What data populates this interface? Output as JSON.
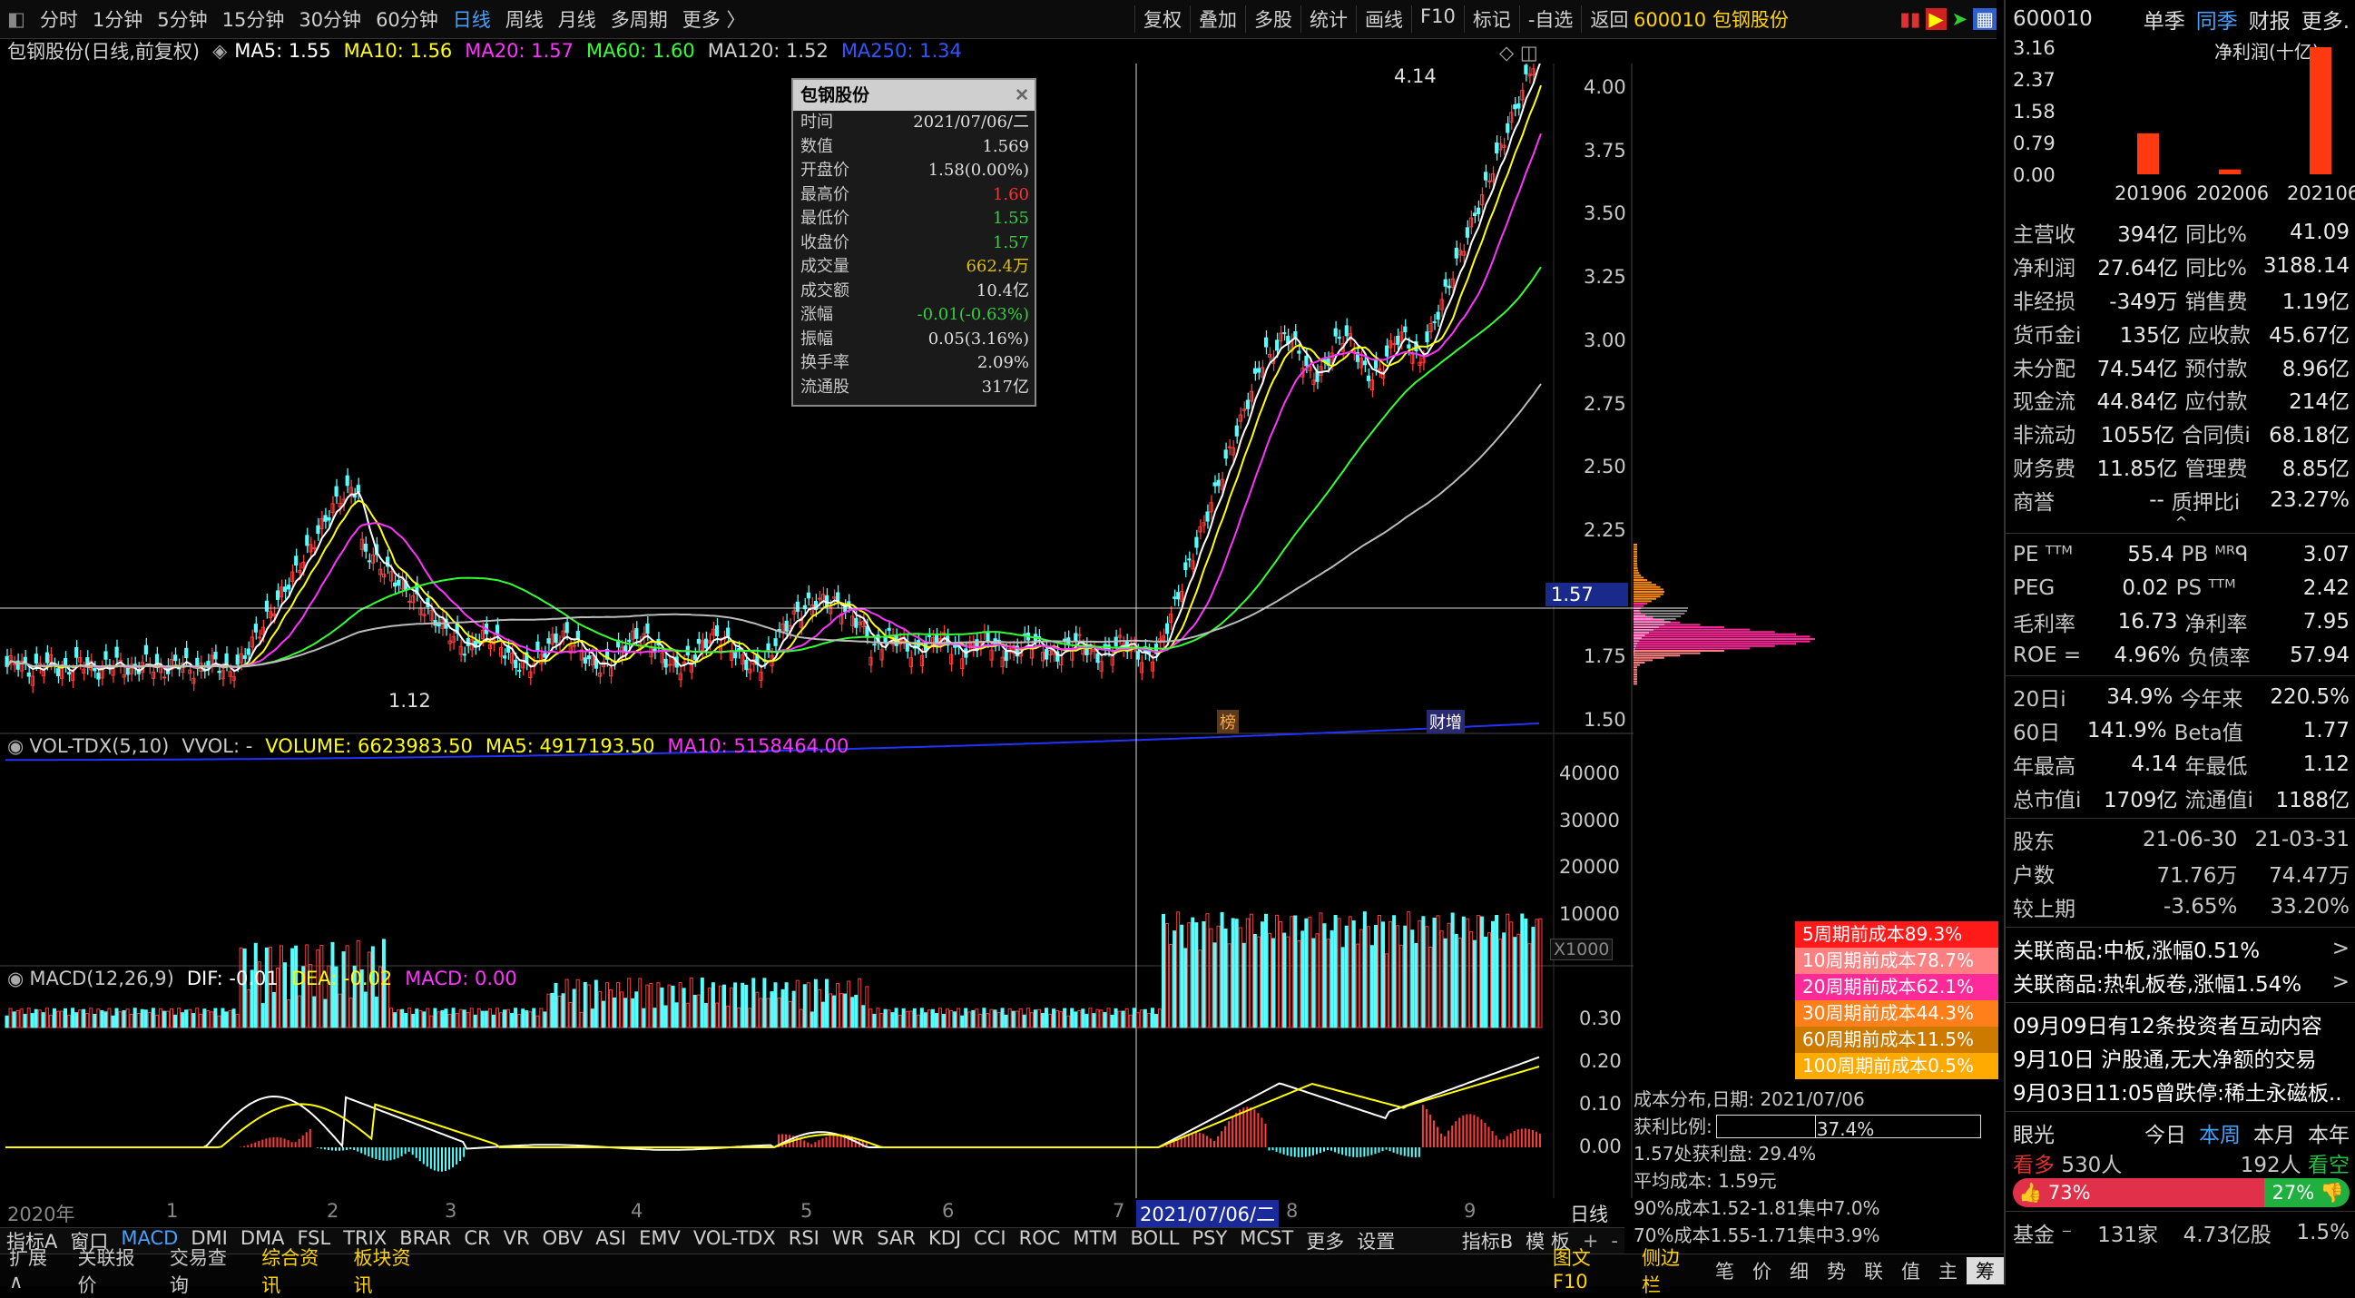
{
  "toolbar": {
    "periods": [
      "分时",
      "1分钟",
      "5分钟",
      "15分钟",
      "30分钟",
      "60分钟",
      "日线",
      "周线",
      "月线",
      "多周期",
      "更多 〉"
    ],
    "active": "日线",
    "actions": [
      "复权",
      "叠加",
      "多股",
      "统计",
      "画线",
      "F10",
      "标记",
      "-自选",
      "返回"
    ]
  },
  "stock_header": {
    "code_name": "600010 包钢股份"
  },
  "main_indicator": {
    "title": "包钢股份(日线,前复权)",
    "ma5": "MA5: 1.55",
    "ma10": "MA10: 1.56",
    "ma20": "MA20: 1.57",
    "ma60": "MA60: 1.60",
    "ma120": "MA120: 1.52",
    "ma250": "MA250: 1.34",
    "high_label": "4.14",
    "low_label": "1.12",
    "price_marker": "1.57",
    "y_ticks": [
      "4.00",
      "3.75",
      "3.50",
      "3.25",
      "3.00",
      "2.75",
      "2.50",
      "2.25",
      "2.00",
      "1.75",
      "1.50"
    ],
    "event_tags": [
      "榜",
      "财增"
    ]
  },
  "tooltip": {
    "title": "包钢股份",
    "rows": [
      {
        "k": "时间",
        "v": "2021/07/06/二"
      },
      {
        "k": "数值",
        "v": "1.569"
      },
      {
        "k": "开盘价",
        "v": "1.58(0.00%)"
      },
      {
        "k": "最高价",
        "v": "1.60"
      },
      {
        "k": "最低价",
        "v": "1.55"
      },
      {
        "k": "收盘价",
        "v": "1.57"
      },
      {
        "k": "成交量",
        "v": "662.4万"
      },
      {
        "k": "成交额",
        "v": "10.4亿"
      },
      {
        "k": "涨幅",
        "v": "-0.01(-0.63%)"
      },
      {
        "k": "振幅",
        "v": "0.05(3.16%)"
      },
      {
        "k": "换手率",
        "v": "2.09%"
      },
      {
        "k": "流通股",
        "v": "317亿"
      }
    ]
  },
  "volume": {
    "title": "VOL-TDX(5,10)",
    "vvol": "VVOL: -",
    "volume": "VOLUME: 6623983.50",
    "ma5": "MA5: 4917193.50",
    "ma10": "MA10: 5158464.00",
    "y_ticks": [
      "40000",
      "30000",
      "20000",
      "10000"
    ],
    "unit": "X1000"
  },
  "macd": {
    "title": "MACD(12,26,9)",
    "dif": "DIF: -0.01",
    "dea": "DEA: -0.02",
    "macd": "MACD: 0.00",
    "y_ticks": [
      "0.30",
      "0.20",
      "0.10",
      "0.00"
    ]
  },
  "xaxis": {
    "labels": [
      "2020年",
      "1",
      "2",
      "3",
      "4",
      "5",
      "6",
      "7",
      "8",
      "9"
    ],
    "cursor_date": "2021/07/06/二",
    "period": "日线"
  },
  "cost_legend": [
    {
      "label": "5周期前成本89.3%",
      "color": "#ff1a1a"
    },
    {
      "label": "10周期前成本78.7%",
      "color": "#ff8080"
    },
    {
      "label": "20周期前成本62.1%",
      "color": "#ff2a9a"
    },
    {
      "label": "30周期前成本44.3%",
      "color": "#ff7f1a"
    },
    {
      "label": "60周期前成本11.5%",
      "color": "#cc7a00"
    },
    {
      "label": "100周期前成本0.5%",
      "color": "#ffaa00"
    }
  ],
  "distribution": {
    "date": "成本分布,日期:  2021/07/06",
    "profit_label": "获利比例:",
    "profit_value": "37.4%",
    "profit_ratio": 0.374,
    "profit_at": "1.57处获利盘: 29.4%",
    "avg_cost": "平均成本: 1.59元",
    "c90": "90%成本1.52-1.81集中7.0%",
    "c70": "70%成本1.55-1.71集中3.9%"
  },
  "bottom_tabs": {
    "left": [
      "指标A",
      "窗口",
      "MACD",
      "DMI",
      "DMA",
      "FSL",
      "TRIX",
      "BRAR",
      "CR",
      "VR",
      "OBV",
      "ASI",
      "EMV",
      "VOL-TDX",
      "RSI",
      "WR",
      "SAR",
      "KDJ",
      "CCI",
      "ROC",
      "MTM",
      "BOLL",
      "PSY",
      "MCST",
      "更多",
      "设置"
    ],
    "active": "MACD",
    "right": [
      "指标B",
      "模 板"
    ]
  },
  "status_bar": {
    "items": [
      "扩展∧",
      "关联报价",
      "交易查询",
      "综合资讯",
      "板块资讯"
    ],
    "right": [
      "图文F10",
      "侧边栏"
    ],
    "tabs": [
      "笔",
      "价",
      "细",
      "势",
      "联",
      "值",
      "主",
      "筹"
    ]
  },
  "right_panel": {
    "code": "600010",
    "tabs": [
      "单季",
      "同季",
      "财报",
      "更多."
    ],
    "active_tab": "同季",
    "chart_title": "净利润(十亿)",
    "chart_data": {
      "type": "bar",
      "categories": [
        "201906",
        "202006",
        "202106"
      ],
      "values": [
        1.02,
        0.12,
        3.16
      ],
      "y_ticks": [
        "3.16",
        "2.37",
        "1.58",
        "0.79",
        "0.00"
      ],
      "title": "净利润(十亿)"
    },
    "fin_rows": [
      [
        "主营收",
        "394亿",
        "同比%",
        "41.09"
      ],
      [
        "净利润",
        "27.64亿",
        "同比%",
        "3188.14"
      ],
      [
        "非经损",
        "-349万",
        "销售费",
        "1.19亿"
      ],
      [
        "货币金i",
        "135亿",
        "应收款",
        "45.67亿"
      ],
      [
        "未分配",
        "74.54亿",
        "预付款",
        "8.96亿"
      ],
      [
        "现金流",
        "44.84亿",
        "应付款",
        "214亿"
      ],
      [
        "非流动",
        "1055亿",
        "合同债i",
        "68.18亿"
      ],
      [
        "财务费",
        "11.85亿",
        "管理费",
        "8.85亿"
      ],
      [
        "商誉",
        "--",
        "质押比i",
        "23.27%"
      ]
    ],
    "val_rows": [
      [
        "PE ᵀᵀᴹ",
        "55.4",
        "PB ᴹᴿᑫ",
        "3.07"
      ],
      [
        "PEG",
        "0.02",
        "PS ᵀᵀᴹ",
        "2.42"
      ],
      [
        "毛利率",
        "16.73",
        "净利率",
        "7.95"
      ],
      [
        "ROE =",
        "4.96%",
        "负债率",
        "57.94"
      ]
    ],
    "perf_rows": [
      [
        "20日i",
        "34.9%",
        "今年来",
        "220.5%"
      ],
      [
        "60日",
        "141.9%",
        "Beta值",
        "1.77"
      ],
      [
        "年最高",
        "4.14",
        "年最低",
        "1.12"
      ],
      [
        "总市值i",
        "1709亿",
        "流通值i",
        "1188亿"
      ]
    ],
    "holder_rows": [
      [
        "股东",
        "21-06-30",
        "21-03-31"
      ],
      [
        "户数",
        "71.76万",
        "74.47万"
      ],
      [
        "较上期",
        "-3.65%",
        "33.20%"
      ]
    ],
    "related": [
      "关联商品:中板,涨幅0.51%",
      "关联商品:热轧板卷,涨幅1.54%"
    ],
    "news": [
      "09月09日有12条投资者互动内容",
      "9月10日 沪股通,无大净额的交易",
      "9月03日11:05曾跌停:稀土永磁板.."
    ],
    "sentiment": {
      "title": "眼光",
      "periods": [
        "今日",
        "本周",
        "本月",
        "本年"
      ],
      "active": "本周",
      "bull_label": "看多",
      "bull_count": "530人",
      "bear_count": "192人",
      "bear_label": "看空",
      "bull_pct": "73%",
      "bear_pct": "27%",
      "bull_ratio": 0.73
    },
    "fund": [
      "基金 ⁻",
      "131家",
      "4.73亿股",
      "1.5%"
    ]
  }
}
